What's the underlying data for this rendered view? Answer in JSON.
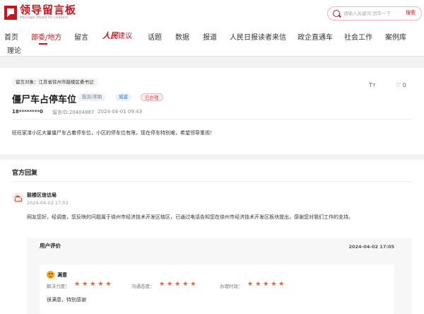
{
  "header": {
    "logo_cn": "领导留言板",
    "logo_en": "Message Board for Leaders",
    "search_placeholder": "请输入关键词 回车一下",
    "search_button": "搜索"
  },
  "nav": {
    "items": [
      "首页",
      "部委/地方",
      "留言",
      "人民建议",
      "话题",
      "数据",
      "报道",
      "人民日报读者来信",
      "政企直通车",
      "社会工作",
      "案例库",
      "理论"
    ],
    "special_script": "人民",
    "special_rest": "建议"
  },
  "message": {
    "target": "留言对象：江苏省徐州市鼓楼区委书记",
    "title": "僵尸车占停车位",
    "tags": {
      "category": "投诉/求助",
      "area": "城建",
      "status": "已办理"
    },
    "user": "18********0",
    "id": "留言ID:20404887",
    "time": "2024-04-01 09:43",
    "font_button": "Tт",
    "like_count": "0",
    "content": "旺旺家漆小区大量僵尸车占着停车位，小区的停车位有限，现在停车特别难，希望领导重视！"
  },
  "reply": {
    "title": "官方回复",
    "org": "鼓楼区信访局",
    "time": "2024-04-02 17:03",
    "content": "网友您好，经调查，您反映的问题属于徐州市经济技术开发区辖区，已通过电话告知您在徐州市经济技术开发区板块提出，感谢您对我们工作的支持。"
  },
  "evaluation": {
    "title": "用户评价",
    "time": "2024-04-02 17:05",
    "mood": "满意",
    "ratings": [
      {
        "label": "解决力度：",
        "stars": 5
      },
      {
        "label": "沟通态度：",
        "stars": 5
      },
      {
        "label": "办理时效：",
        "stars": 5
      }
    ],
    "comment": "很满意，特别感谢"
  },
  "colors": {
    "brand": "#c9151e",
    "star": "#ef5b3c"
  }
}
